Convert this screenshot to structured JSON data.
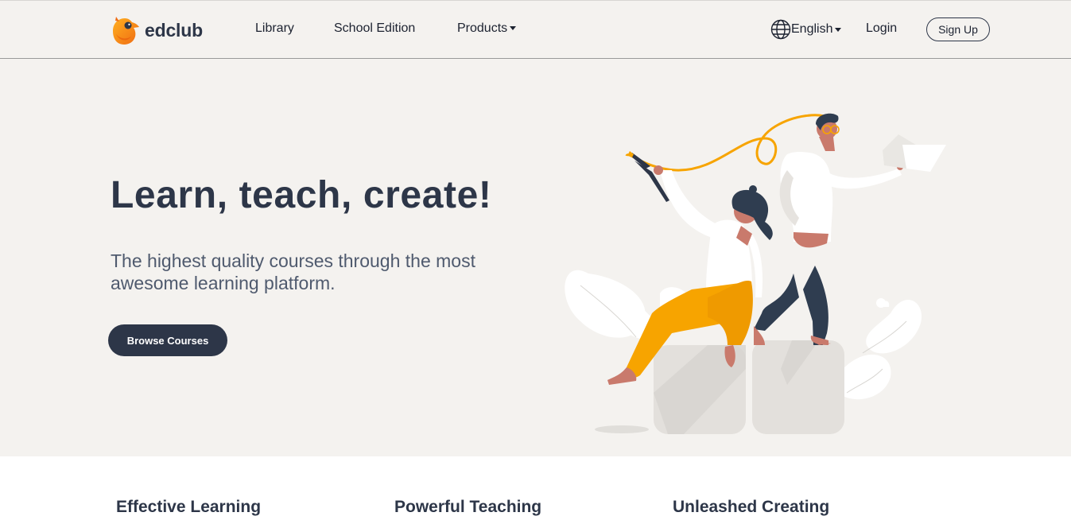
{
  "brand": {
    "name": "edclub"
  },
  "nav": {
    "library": "Library",
    "school_edition": "School Edition",
    "products": "Products",
    "language": "English",
    "login": "Login",
    "signup": "Sign Up"
  },
  "hero": {
    "title": "Learn, teach, create!",
    "subtitle": "The highest quality courses through the most awesome learning platform.",
    "cta": "Browse Courses"
  },
  "features": [
    {
      "title": "Effective Learning"
    },
    {
      "title": "Powerful Teaching"
    },
    {
      "title": "Unleashed Creating"
    }
  ],
  "icons": {
    "logo": "bird-logo-icon",
    "products_menu": "caret-down-icon",
    "language": "globe-icon",
    "language_menu": "caret-down-icon"
  },
  "colors": {
    "navy": "#2d3648",
    "hero_background": "#f4f2ef",
    "accent_orange": "#f7a400"
  }
}
